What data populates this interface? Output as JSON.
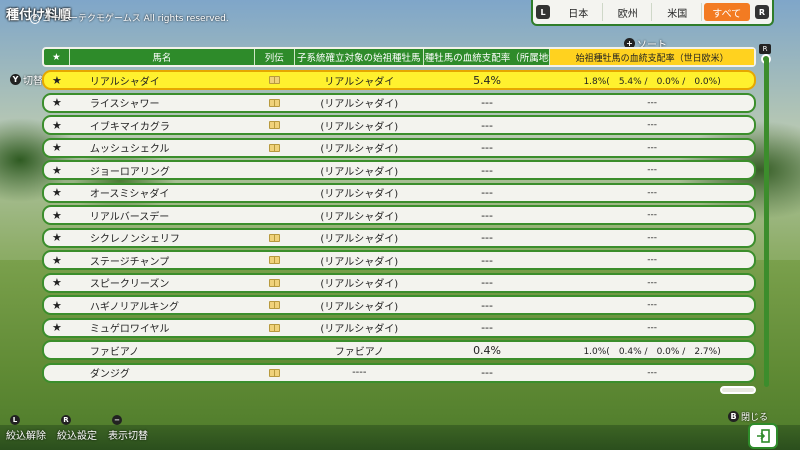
{
  "header": {
    "title": "種付け料順",
    "copyright": "コーエーテクモゲームス All rights reserved.",
    "copyright_mark": "C"
  },
  "region_tabs": {
    "left_button": "L",
    "right_button": "R",
    "items": [
      "日本",
      "欧州",
      "米国",
      "すべて"
    ],
    "active": "すべて"
  },
  "sort": {
    "button": "+",
    "label": "ソート"
  },
  "filter": {
    "button": "Y",
    "label": "切替"
  },
  "table": {
    "columns": [
      "★",
      "馬名",
      "列伝",
      "子系統確立対象の始祖種牡馬",
      "始祖種牡馬の血統支配率（所属地域）",
      "始祖種牡馬の血統支配率（世日欧米）"
    ],
    "rows": [
      {
        "star": "★",
        "name": "リアルシャダイ",
        "book": true,
        "founder": "リアルシャダイ",
        "local": "5.4%",
        "world": "1.8%(　5.4% /　0.0% /　0.0%)",
        "selected": true
      },
      {
        "star": "★",
        "name": "ライスシャワー",
        "book": true,
        "founder": "(リアルシャダイ)",
        "local": "---",
        "world": "---"
      },
      {
        "star": "★",
        "name": "イブキマイカグラ",
        "book": true,
        "founder": "(リアルシャダイ)",
        "local": "---",
        "world": "---"
      },
      {
        "star": "★",
        "name": "ムッシュシェクル",
        "book": true,
        "founder": "(リアルシャダイ)",
        "local": "---",
        "world": "---"
      },
      {
        "star": "★",
        "name": "ジョーロアリング",
        "book": false,
        "founder": "(リアルシャダイ)",
        "local": "---",
        "world": "---"
      },
      {
        "star": "★",
        "name": "オースミシャダイ",
        "book": false,
        "founder": "(リアルシャダイ)",
        "local": "---",
        "world": "---"
      },
      {
        "star": "★",
        "name": "リアルバースデー",
        "book": false,
        "founder": "(リアルシャダイ)",
        "local": "---",
        "world": "---"
      },
      {
        "star": "★",
        "name": "シクレノンシェリフ",
        "book": true,
        "founder": "(リアルシャダイ)",
        "local": "---",
        "world": "---"
      },
      {
        "star": "★",
        "name": "ステージチャンプ",
        "book": true,
        "founder": "(リアルシャダイ)",
        "local": "---",
        "world": "---"
      },
      {
        "star": "★",
        "name": "スピークリーズン",
        "book": true,
        "founder": "(リアルシャダイ)",
        "local": "---",
        "world": "---"
      },
      {
        "star": "★",
        "name": "ハギノリアルキング",
        "book": true,
        "founder": "(リアルシャダイ)",
        "local": "---",
        "world": "---"
      },
      {
        "star": "★",
        "name": "ミュゲロワイヤル",
        "book": true,
        "founder": "(リアルシャダイ)",
        "local": "---",
        "world": "---"
      },
      {
        "star": "",
        "name": "ファビアノ",
        "book": false,
        "founder": "ファビアノ",
        "local": "0.4%",
        "world": "1.0%(　0.4% /　0.0% /　2.7%)"
      },
      {
        "star": "",
        "name": "ダンジグ",
        "book": true,
        "founder": "----",
        "local": "---",
        "world": "---"
      }
    ]
  },
  "scroll_hint": "R",
  "bottom": {
    "buttons": [
      {
        "key": "L",
        "label": "絞込解除"
      },
      {
        "key": "R",
        "label": "絞込設定"
      },
      {
        "key": "−",
        "label": "表示切替"
      }
    ],
    "close_key": "B",
    "close_label": "閉じる"
  },
  "colors": {
    "accent": "#2e8b2a",
    "active_tab": "#f37b22",
    "selected_row": "#fff12e",
    "sorted_header": "#ffd21f"
  }
}
